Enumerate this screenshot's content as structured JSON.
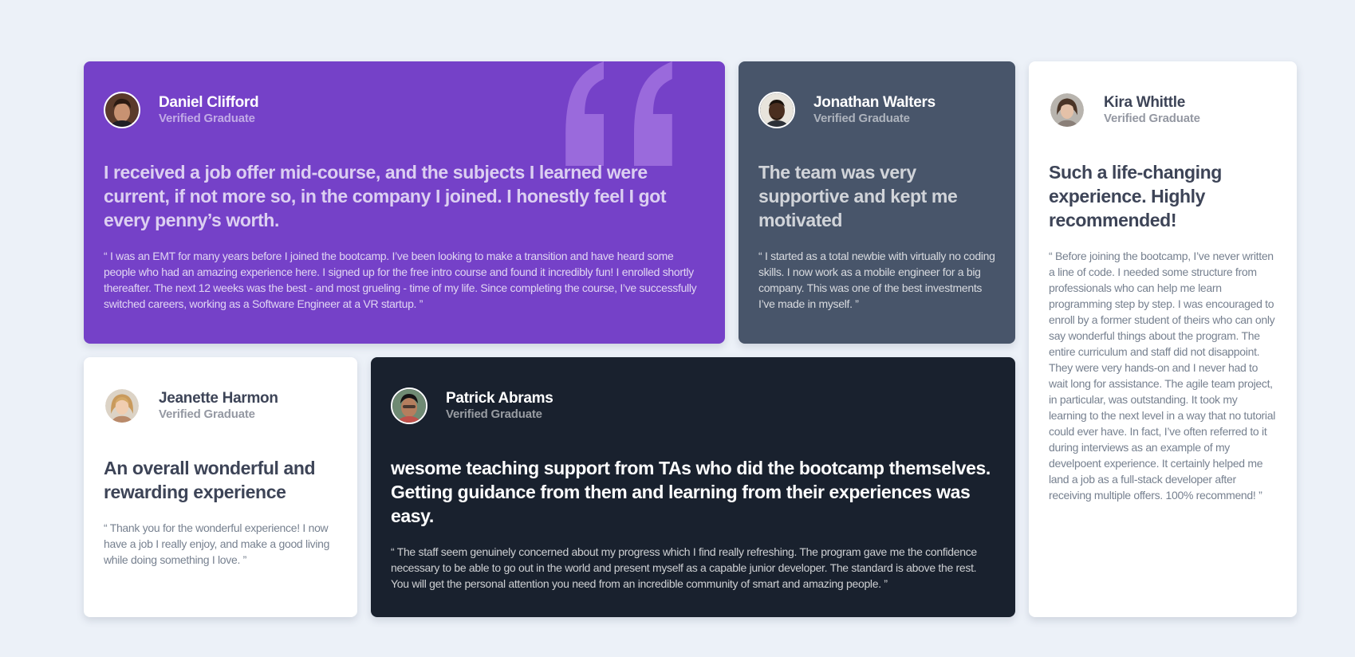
{
  "colors": {
    "background": "#ecf1f8",
    "purple": "#7541c8",
    "grayish_blue": "#48556a",
    "dark_blackish_blue": "#19212e",
    "white": "#ffffff",
    "quote_mark": "#9a6adc"
  },
  "testimonials": [
    {
      "name": "Daniel Clifford",
      "role": "Verified Graduate",
      "avatar": "avatar-daniel",
      "headline": "I received a job offer mid-course, and the subjects I learned were current, if not more so, in the company I joined. I honestly feel I got every penny’s worth.",
      "body": "“ I was an EMT for many years before I joined the bootcamp. I’ve been looking to make a transition and have heard some people who had an amazing experience here. I signed up for the free intro course and found it incredibly fun! I enrolled shortly thereafter. The next 12 weeks was the best - and most grueling - time of my life. Since completing the course, I’ve successfully switched careers, working as a Software Engineer at a VR startup. ”"
    },
    {
      "name": "Jonathan Walters",
      "role": "Verified Graduate",
      "avatar": "avatar-jonathan",
      "headline": "The team was very supportive and kept me motivated",
      "body": "“ I started as a total newbie with virtually no coding skills. I now work as a mobile engineer for a big company. This was one of the best investments I’ve made in myself. ”"
    },
    {
      "name": "Kira Whittle",
      "role": "Verified Graduate",
      "avatar": "avatar-kira",
      "headline": "Such a life-changing experience. Highly recommended!",
      "body": "“ Before joining the bootcamp, I’ve never written a line of code. I needed some structure from professionals who can help me learn programming step by step. I was encouraged to enroll by a former student of theirs who can only say wonderful things about the program. The entire curriculum and staff did not disappoint. They were very hands-on and I never had to wait long for assistance. The agile team project, in particular, was outstanding. It took my learning to the next level in a way that no tutorial could ever have. In fact, I’ve often referred to it during interviews as an example of my develpoent experience. It certainly helped me land a job as a full-stack developer after receiving multiple offers. 100% recommend! ”"
    },
    {
      "name": "Jeanette Harmon",
      "role": "Verified Graduate",
      "avatar": "avatar-jeanette",
      "headline": "An overall wonderful and rewarding experience",
      "body": "“ Thank you for the wonderful experience! I now have a job I really enjoy, and make a good living while doing something I love. ”"
    },
    {
      "name": "Patrick Abrams",
      "role": "Verified Graduate",
      "avatar": "avatar-patrick",
      "headline": "wesome teaching support from TAs who did the bootcamp themselves. Getting guidance from them and learning from their experiences was easy.",
      "body": "“ The staff seem genuinely concerned about my progress which I find really refreshing. The program gave me the confidence necessary to be able to go out in the world and present myself as a capable junior developer. The standard is above the rest. You will get the personal attention you need from an incredible community of smart and amazing people. ”"
    }
  ]
}
